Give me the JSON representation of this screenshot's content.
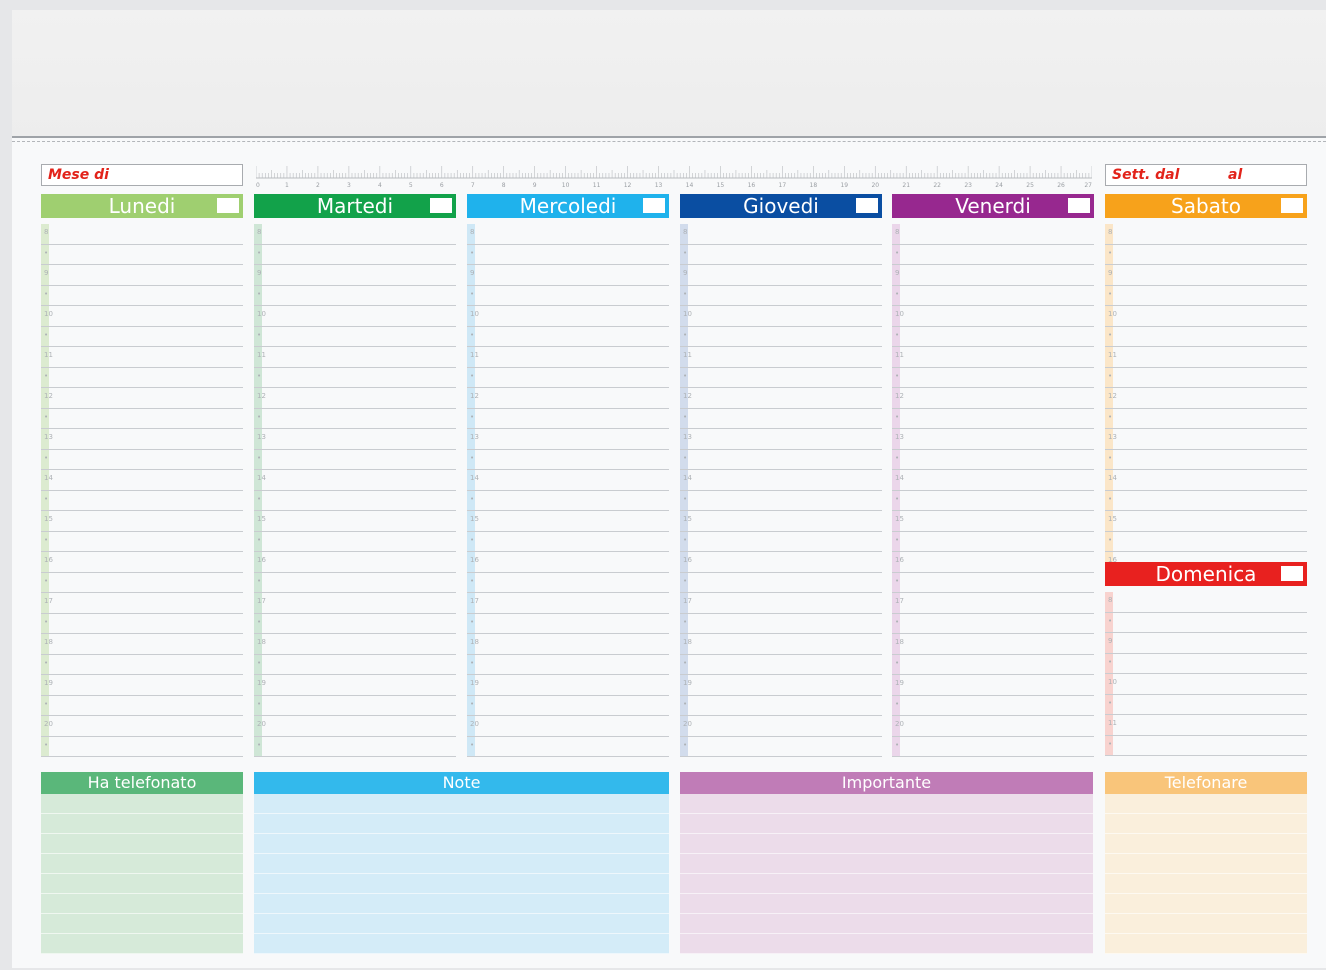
{
  "header": {
    "month_label": "Mese di",
    "week_from_label": "Sett. dal",
    "week_to_label": "al"
  },
  "ruler": {
    "ticks": [
      "0",
      "1",
      "2",
      "3",
      "4",
      "5",
      "6",
      "7",
      "8",
      "9",
      "10",
      "11",
      "12",
      "13",
      "14",
      "15",
      "16",
      "17",
      "18",
      "19",
      "20",
      "21",
      "22",
      "23",
      "24",
      "25",
      "26",
      "27"
    ]
  },
  "days": [
    {
      "name": "Lunedi",
      "color": "#9fcf70",
      "strip": "#dcebd0"
    },
    {
      "name": "Martedi",
      "color": "#12a24a",
      "strip": "#cfe6d6"
    },
    {
      "name": "Mercoledi",
      "color": "#1fb2ec",
      "strip": "#cfe8f6"
    },
    {
      "name": "Giovedi",
      "color": "#0a4ea2",
      "strip": "#d2dcec"
    },
    {
      "name": "Venerdi",
      "color": "#97288f",
      "strip": "#ebd6ea"
    },
    {
      "name": "Sabato",
      "color": "#f7a21b",
      "strip": "#fbe6c8"
    },
    {
      "name": "Domenica",
      "color": "#e8211f",
      "strip": "#f8d3cf"
    }
  ],
  "hours_full": [
    "8",
    "•",
    "9",
    "•",
    "10",
    "•",
    "11",
    "•",
    "12",
    "•",
    "13",
    "•",
    "14",
    "•",
    "15",
    "•",
    "16",
    "•",
    "17",
    "•",
    "18",
    "•",
    "19",
    "•",
    "20",
    "•"
  ],
  "hours_saturday": [
    "8",
    "•",
    "9",
    "•",
    "10",
    "•",
    "11",
    "•",
    "12",
    "•",
    "13",
    "•",
    "14",
    "•",
    "15",
    "•",
    "16"
  ],
  "hours_sunday": [
    "8",
    "•",
    "9",
    "•",
    "10",
    "•",
    "11",
    "•"
  ],
  "bottom_sections": [
    {
      "label": "Ha telefonato",
      "head": "#5ab77a",
      "body": "#d6ead9"
    },
    {
      "label": "Note",
      "head": "#33b9ec",
      "body": "#d4ecf8"
    },
    {
      "label": "Importante",
      "head": "#c07cb7",
      "body": "#ecdcea"
    },
    {
      "label": "Telefonare",
      "head": "#f9c57a",
      "body": "#faefdc"
    }
  ]
}
